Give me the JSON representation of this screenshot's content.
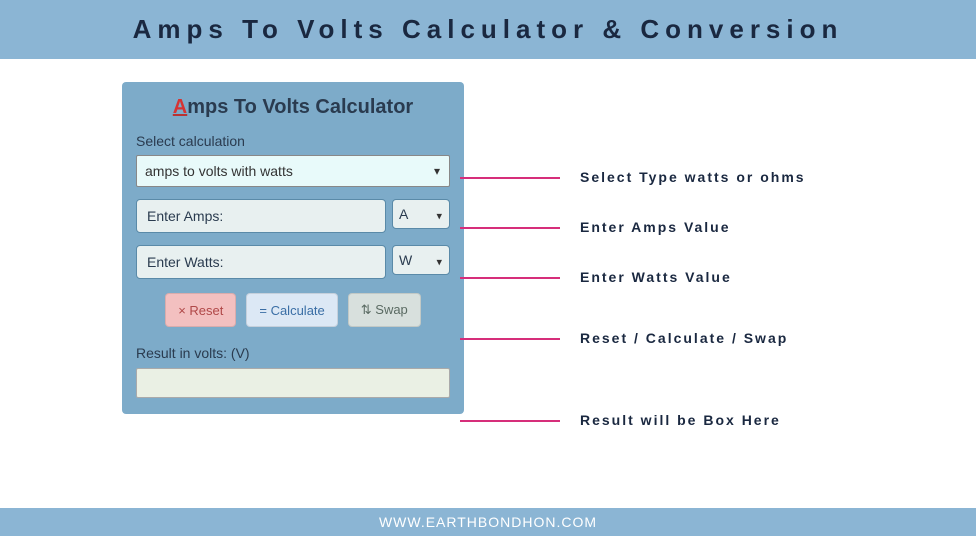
{
  "header": {
    "title": "Amps To Volts Calculator & Conversion"
  },
  "calculator": {
    "title_first_letter": "A",
    "title_rest": "mps To Volts Calculator",
    "select_label": "Select calculation",
    "select_value": "amps to volts with watts",
    "amps_placeholder": "Enter Amps:",
    "amps_unit": "A",
    "watts_placeholder": "Enter Watts:",
    "watts_unit": "W",
    "reset_btn": "× Reset",
    "calc_btn": "= Calculate",
    "swap_btn": "⇅ Swap",
    "result_label": "Result in volts: (V)"
  },
  "annotations": {
    "a1": "Select Type watts or ohms",
    "a2": "Enter Amps Value",
    "a3": "Enter Watts Value",
    "a4": "Reset / Calculate / Swap",
    "a5": "Result will be Box Here"
  },
  "footer": {
    "text": "WWW.EARTHBONDHON.COM"
  }
}
